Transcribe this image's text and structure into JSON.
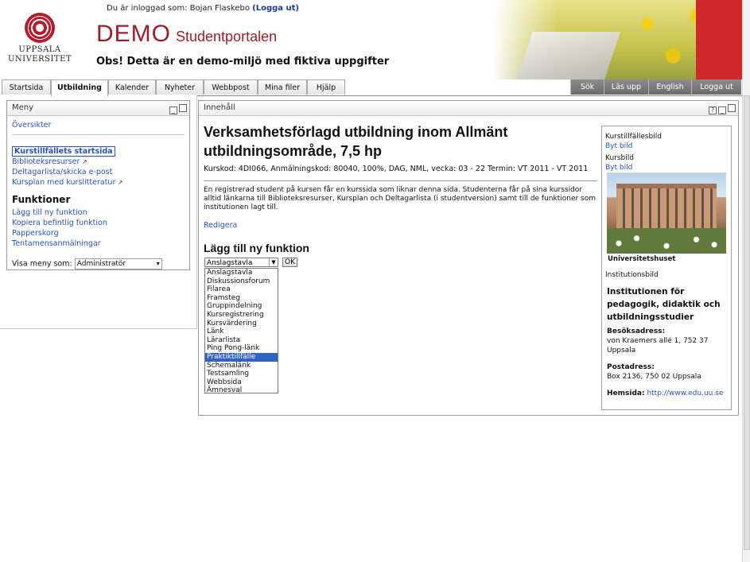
{
  "header": {
    "logged_in_text": "Du är inloggad som: Bojan Flaskebo",
    "logout_link": "(Logga ut)",
    "university_line1": "UPPSALA",
    "university_line2": "UNIVERSITET",
    "demo_big": "DEMO",
    "demo_small": "Studentportalen",
    "demo_note": "Obs! Detta är en demo-miljö med fiktiva uppgifter"
  },
  "nav": {
    "tabs": [
      "Startsida",
      "Utbildning",
      "Kalender",
      "Nyheter",
      "Webbpost",
      "Mina filer",
      "Hjälp"
    ],
    "active_tab": "Utbildning",
    "right_tabs": [
      "Sök",
      "Läs upp",
      "English",
      "Logga ut"
    ]
  },
  "menu": {
    "title": "Meny",
    "overview": "Översikter",
    "current_item": "Kurstillfällets startsida",
    "links": [
      "Biblioteksresurser",
      "Deltagarlista/skicka e-post",
      "Kursplan med kurslitteratur"
    ],
    "functions_title": "Funktioner",
    "function_links": [
      "Lägg till ny funktion",
      "Kopiera befintlig funktion",
      "Papperskorg",
      "Tentamensanmälningar"
    ],
    "view_as_label": "Visa meny som:",
    "view_as_value": "Administratör"
  },
  "content": {
    "panel_title": "Innehåll",
    "course_title": "Verksamhetsförlagd utbildning inom Allmänt utbildningsområde, 7,5 hp",
    "course_meta": "Kurskod: 4DI066, Anmälningskod: 80040, 100%, DAG, NML, vecka: 03 - 22 Termin: VT 2011 - VT 2011",
    "course_desc": "En registrerad student på kursen får en kurssida som liknar denna sida. Studenterna får på sina kurssidor alltid länkarna till Biblioteksresurser, Kursplan och Deltagarlista (i studentversion) samt till de funktioner som institutionen lagt till.",
    "edit_link": "Redigera",
    "add_function_title": "Lägg till ny funktion",
    "selected_function": "Anslagstavla",
    "ok_label": "OK",
    "function_options": [
      "Anslagstavla",
      "Diskussionsforum",
      "Filarea",
      "Framsteg",
      "Gruppindelning",
      "Kursregistrering",
      "Kursvärdering",
      "Länk",
      "Lärarlista",
      "Ping Pong-länk",
      "Praktiktillfälle",
      "Schemalänk",
      "Testsamling",
      "Webbsida",
      "Ämnesval"
    ],
    "highlighted_option": "Praktiktillfälle"
  },
  "info": {
    "course_image_label": "Kurstillfällesbild",
    "change_image_1": "Byt bild",
    "course_label": "Kursbild",
    "change_image_2": "Byt bild",
    "photo_caption": "Universitetshuset",
    "institution_image_label": "Institutionsbild",
    "institution_name": "Institutionen för pedagogik, didaktik och utbildningsstudier",
    "visit_label": "Besöksadress:",
    "visit_address": "von Kraemers allé 1, 752 37 Uppsala",
    "post_label": "Postadress:",
    "post_address": "Box 2136, 750 02 Uppsala",
    "homepage_label": "Hemsida:",
    "homepage_url": "http://www.edu.uu.se"
  },
  "colors": {
    "brand_red": "#a01c2c",
    "link_blue": "#2a52b4",
    "selection_blue": "#3163c5"
  }
}
